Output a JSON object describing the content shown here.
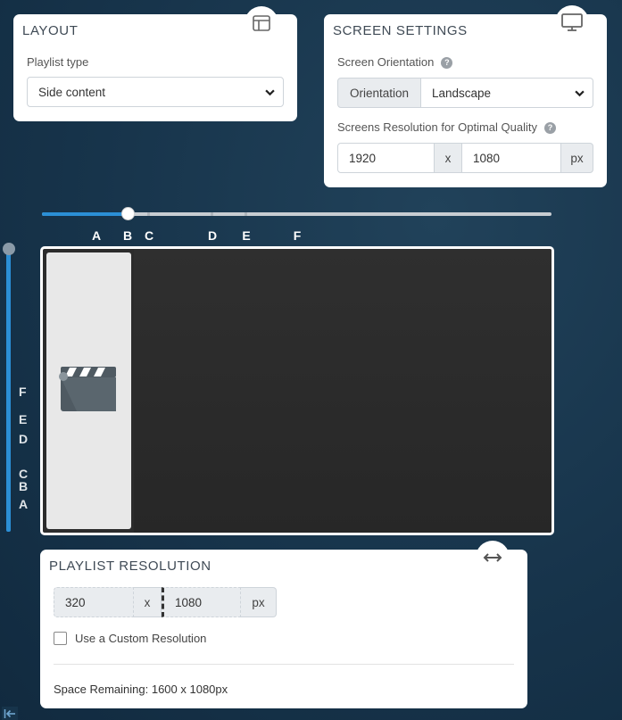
{
  "layout": {
    "title": "LAYOUT",
    "playlist_type_label": "Playlist type",
    "playlist_type_value": "Side content",
    "icon": "layout-icon"
  },
  "screen_settings": {
    "title": "SCREEN SETTINGS",
    "orientation_label": "Screen Orientation",
    "orientation_addon": "Orientation",
    "orientation_value": "Landscape",
    "resolution_label": "Screens Resolution for Optimal Quality",
    "width": "1920",
    "separator": "x",
    "height": "1080",
    "unit": "px",
    "icon": "monitor-icon",
    "help_icon": "question-icon"
  },
  "horizontal_slider": {
    "ticks": [
      "A",
      "B",
      "C",
      "D",
      "E",
      "F"
    ],
    "value_fraction": 0.167,
    "accent_color": "#2b8fd6"
  },
  "vertical_slider": {
    "ticks": [
      "F",
      "E",
      "D",
      "C",
      "B",
      "A"
    ],
    "accent_color": "#2b8fd6"
  },
  "preview": {
    "side_icon": "clapperboard-icon",
    "main_bg": "#2c2c2c",
    "side_bg": "#e8e8e8"
  },
  "playlist_resolution": {
    "title": "PLAYLIST RESOLUTION",
    "width": "320",
    "separator": "x",
    "height": "1080",
    "unit": "px",
    "custom_label": "Use a Custom Resolution",
    "custom_checked": false,
    "space_remaining": "Space Remaining: 1600 x 1080px",
    "icon": "horizontal-resize-icon"
  },
  "footer": {
    "collapse_icon": "collapse-left-icon"
  }
}
